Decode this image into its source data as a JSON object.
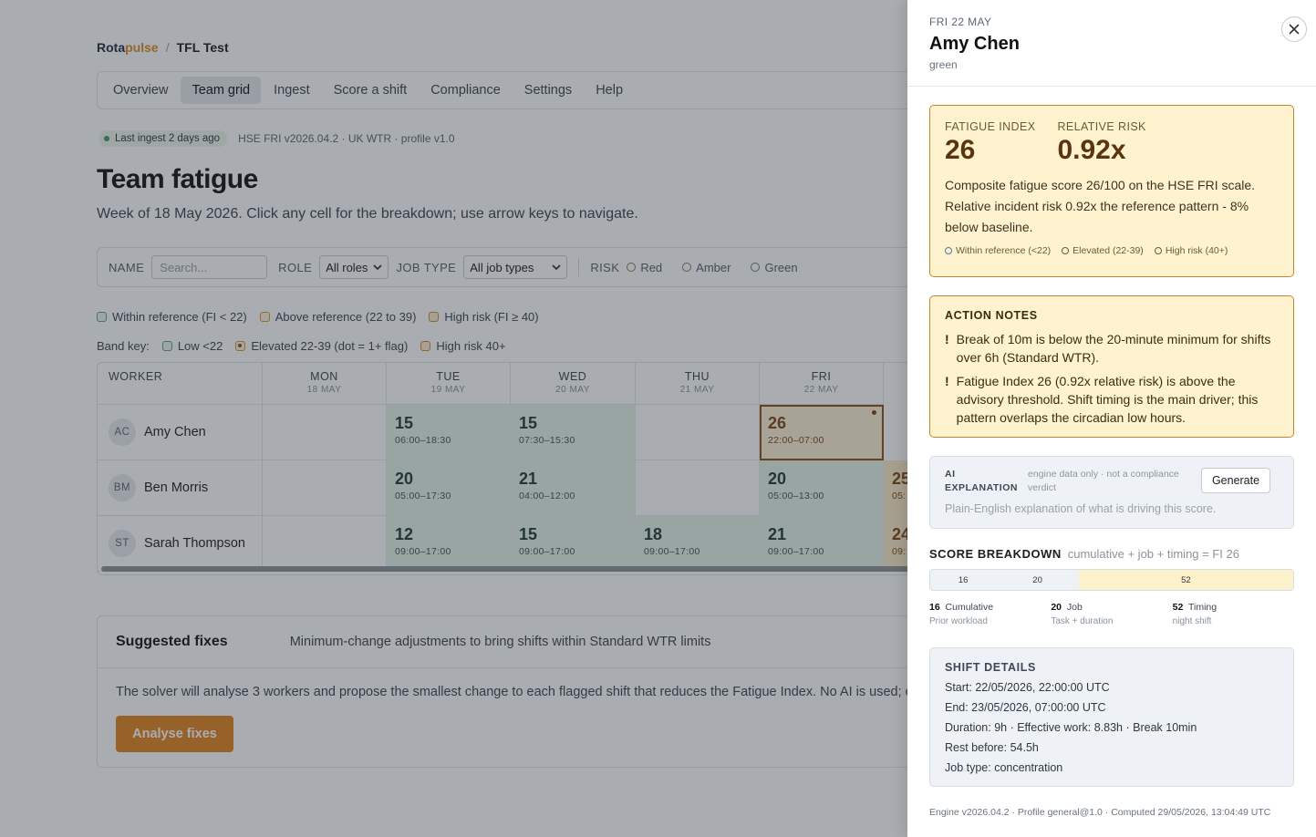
{
  "brand": {
    "name_part1": "Rota",
    "name_part2": "pulse",
    "separator": "/",
    "project": "TFL Test"
  },
  "nav": {
    "items": [
      {
        "label": "Overview",
        "active": false
      },
      {
        "label": "Team grid",
        "active": true
      },
      {
        "label": "Ingest",
        "active": false
      },
      {
        "label": "Score a shift",
        "active": false
      },
      {
        "label": "Compliance",
        "active": false
      },
      {
        "label": "Settings",
        "active": false
      },
      {
        "label": "Help",
        "active": false
      }
    ]
  },
  "status": {
    "ingest_pill": "Last ingest 2 days ago",
    "engine_info": "HSE FRI v2026.04.2 · UK WTR · profile v1.0"
  },
  "page": {
    "title": "Team fatigue",
    "subtitle": "Week of 18 May 2026. Click any cell for the breakdown; use arrow keys to navigate."
  },
  "filters": {
    "name_label": "NAME",
    "name_placeholder": "Search...",
    "role_label": "ROLE",
    "role_value": "All roles",
    "jobtype_label": "JOB TYPE",
    "jobtype_value": "All job types",
    "risk_label": "RISK",
    "risk_red": "Red",
    "risk_amber": "Amber",
    "risk_green": "Green"
  },
  "legend": {
    "within": "Within reference (FI < 22)",
    "above": "Above reference (22 to 39)",
    "high": "High risk (FI ≥ 40)",
    "band_key_label": "Band key:",
    "band_low": "Low <22",
    "band_elevated": "Elevated 22-39 (dot = 1+ flag)",
    "band_high": "High risk 40+"
  },
  "grid": {
    "worker_header": "WORKER",
    "days": [
      {
        "name": "MON",
        "date": "18 MAY"
      },
      {
        "name": "TUE",
        "date": "19 MAY"
      },
      {
        "name": "WED",
        "date": "20 MAY"
      },
      {
        "name": "THU",
        "date": "21 MAY"
      },
      {
        "name": "FRI",
        "date": "22 MAY"
      }
    ],
    "rows": [
      {
        "initials": "AC",
        "name": "Amy Chen",
        "cells": [
          {
            "score": "",
            "time": ""
          },
          {
            "score": "15",
            "time": "06:00–18:30"
          },
          {
            "score": "15",
            "time": "07:30–15:30"
          },
          {
            "score": "",
            "time": ""
          },
          {
            "score": "26",
            "time": "22:00–07:00"
          }
        ]
      },
      {
        "initials": "BM",
        "name": "Ben Morris",
        "cells": [
          {
            "score": "",
            "time": ""
          },
          {
            "score": "20",
            "time": "05:00–17:30"
          },
          {
            "score": "21",
            "time": "04:00–12:00"
          },
          {
            "score": "",
            "time": ""
          },
          {
            "score": "20",
            "time": "05:00–13:00"
          },
          {
            "score": "25",
            "time": "05:"
          }
        ]
      },
      {
        "initials": "ST",
        "name": "Sarah Thompson",
        "cells": [
          {
            "score": "",
            "time": ""
          },
          {
            "score": "12",
            "time": "09:00–17:00"
          },
          {
            "score": "15",
            "time": "09:00–17:00"
          },
          {
            "score": "18",
            "time": "09:00–17:00"
          },
          {
            "score": "21",
            "time": "09:00–17:00"
          },
          {
            "score": "24",
            "time": "09:"
          }
        ]
      }
    ]
  },
  "fixes": {
    "title": "Suggested fixes",
    "subtitle": "Minimum-change adjustments to bring shifts within Standard WTR limits",
    "body": "The solver will analyse 3 workers and propose the smallest change to each flagged shift that reduces the Fatigue Index. No AI is used; e",
    "button": "Analyse fixes"
  },
  "drawer": {
    "date": "FRI 22 MAY",
    "worker": "Amy Chen",
    "band": "green",
    "fi_label": "FATIGUE INDEX",
    "fi_value": "26",
    "rr_label": "RELATIVE RISK",
    "rr_value": "0.92x",
    "description": "Composite fatigue score 26/100 on the HSE FRI scale. Relative incident risk 0.92x the reference pattern - 8% below baseline.",
    "legend_within": "Within reference (<22)",
    "legend_elevated": "Elevated (22-39)",
    "legend_high": "High risk (40+)",
    "action_title": "ACTION NOTES",
    "action_notes": [
      "Break of 10m is below the 20-minute minimum for shifts over 6h (Standard WTR).",
      "Fatigue Index 26 (0.92x relative risk) is above the advisory threshold. Shift timing is the main driver; this pattern overlaps the circadian low hours."
    ],
    "ai_label_1": "AI",
    "ai_label_2": "EXPLANATION",
    "ai_note": "engine data only · not a compliance verdict",
    "ai_button": "Generate",
    "ai_placeholder": "Plain-English explanation of what is driving this score.",
    "breakdown_title": "SCORE BREAKDOWN",
    "breakdown_formula": "cumulative + job + timing = FI 26",
    "breakdown": [
      {
        "value": "16",
        "name": "Cumulative",
        "note": "Prior workload",
        "color": "#eef2f7"
      },
      {
        "value": "20",
        "name": "Job",
        "note": "Task + duration",
        "color": "#eef2f7"
      },
      {
        "value": "52",
        "name": "Timing",
        "note": "night shift",
        "color": "#fdf1cc"
      }
    ],
    "shift_title": "SHIFT DETAILS",
    "shift_lines": [
      "Start: 22/05/2026, 22:00:00 UTC",
      "End: 23/05/2026, 07:00:00 UTC",
      "Duration: 9h · Effective work: 8.83h · Break 10min",
      "Rest before: 54.5h",
      "Job type: concentration"
    ],
    "footer": "Engine v2026.04.2 · Profile general@1.0 · Computed 29/05/2026, 13:04:49 UTC"
  },
  "colors": {
    "accent": "#df8420",
    "green_cell": "#e3f3e8",
    "amber_cell": "#fdebc8",
    "amber_border": "#c8862c"
  }
}
